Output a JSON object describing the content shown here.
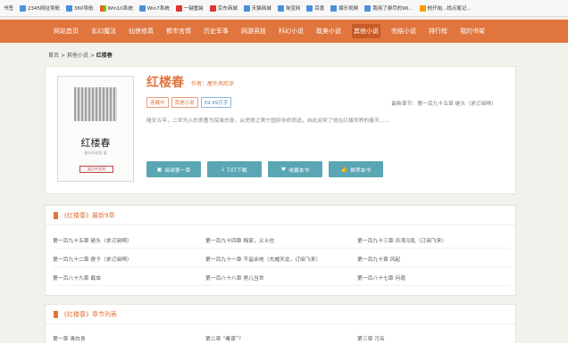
{
  "bookmarks": [
    {
      "label": "书签",
      "icon": "none"
    },
    {
      "label": "2345网址导航",
      "icon": "globe-icon"
    },
    {
      "label": "360导航",
      "icon": "globe-icon"
    },
    {
      "label": "Win10系统",
      "icon": "windows-icon"
    },
    {
      "label": "Win7系统",
      "icon": "globe-icon"
    },
    {
      "label": "一键重装",
      "icon": "flag-icon"
    },
    {
      "label": "京东商城",
      "icon": "red-square-icon"
    },
    {
      "label": "天猫商城",
      "icon": "globe-icon"
    },
    {
      "label": "淘宝网",
      "icon": "globe-icon"
    },
    {
      "label": "百度",
      "icon": "globe-icon"
    },
    {
      "label": "娱乐视频",
      "icon": "globe-icon"
    },
    {
      "label": "我用了费尽的96...",
      "icon": "globe-icon"
    },
    {
      "label": "他开始...找点笔记...",
      "icon": "orange-icon"
    }
  ],
  "nav": [
    "网站首页",
    "玄幻魔法",
    "仙侠修真",
    "都市言情",
    "历史军事",
    "网游竞技",
    "科幻小说",
    "耽美小说",
    "其他小说",
    "完结小说",
    "排行榜",
    "我的书架"
  ],
  "nav_active": "其他小说",
  "breadcrumb": {
    "home": "首页",
    "sep1": ">",
    "cat": "其他小说",
    "sep2": ">",
    "current": "红楼春"
  },
  "book": {
    "title": "红楼春",
    "author": "作者：屋外风吹凉",
    "tags": [
      "连载中",
      "其他小说",
      "59.99万字"
    ],
    "latest": "最新章节：第一百九十五章 砸头（求订阅啊）",
    "intro": "隆安五年，二世为人的贾蔷为保清白身，从虎狼之窝宁国府夺命而逃，自此迎来了他在红楼世界的春天......",
    "cover": {
      "title": "红楼春",
      "subtitle": "屋外风吹凉 著",
      "logo": "起点中文网"
    }
  },
  "buttons": {
    "read": "阅读第一章",
    "txt": "TXT下载",
    "fav": "收藏本书",
    "rec": "推荐本书"
  },
  "latest_section": {
    "title": "《红楼春》最新9章"
  },
  "latest_chapters": [
    "第一百九十五章 砸头（求订阅啊）",
    "第一百九十四章 梅家，义士也",
    "第一百九十三章 兵湾马乱（订阅飞来）",
    "第一百九十二章 傻子（求订阅啊）",
    "第一百九十一章 不留余地（大威天龙，订阅飞来）",
    "第一百九十章 风起",
    "第一百八十九章 截虫",
    "第一百八十八章 男儿当世",
    "第一百八十七章 问道"
  ],
  "list_section": {
    "title": "《红楼春》章节列表"
  },
  "list_chapters": [
    "第一章 清白身",
    "第二章 “毒谋”？",
    "第三章 污名"
  ]
}
